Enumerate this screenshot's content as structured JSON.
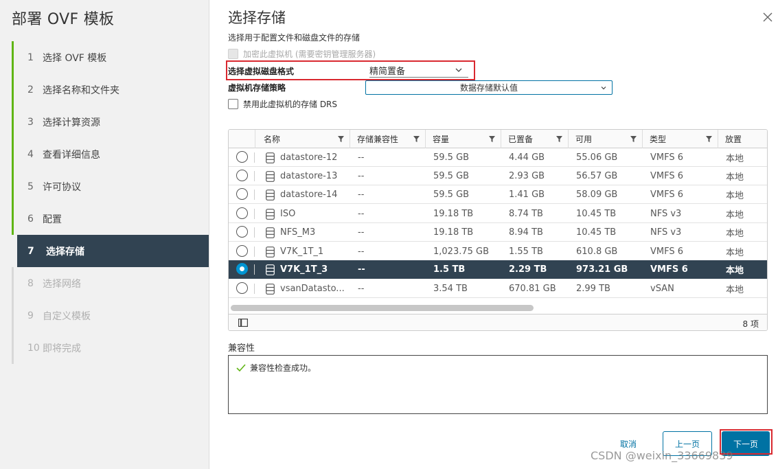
{
  "wizard": {
    "title": "部署 OVF 模板",
    "steps": [
      {
        "num": "1",
        "label": "选择 OVF 模板",
        "state": "done"
      },
      {
        "num": "2",
        "label": "选择名称和文件夹",
        "state": "done"
      },
      {
        "num": "3",
        "label": "选择计算资源",
        "state": "done"
      },
      {
        "num": "4",
        "label": "查看详细信息",
        "state": "done"
      },
      {
        "num": "5",
        "label": "许可协议",
        "state": "done"
      },
      {
        "num": "6",
        "label": "配置",
        "state": "done"
      },
      {
        "num": "7",
        "label": "选择存储",
        "state": "active"
      },
      {
        "num": "8",
        "label": "选择网络",
        "state": "future"
      },
      {
        "num": "9",
        "label": "自定义模板",
        "state": "future"
      },
      {
        "num": "10",
        "label": "即将完成",
        "state": "future"
      }
    ]
  },
  "page": {
    "title": "选择存储",
    "subtitle": "选择用于配置文件和磁盘文件的存储",
    "encrypt_label": "加密此虚拟机 (需要密钥管理服务器)",
    "disk_format_label": "选择虚拟磁盘格式",
    "disk_format_value": "精简置备",
    "policy_label": "虚拟机存储策略",
    "policy_value": "数据存储默认值",
    "disable_drs_label": "禁用此虚拟机的存储 DRS"
  },
  "grid": {
    "columns": [
      "名称",
      "存储兼容性",
      "容量",
      "已置备",
      "可用",
      "类型",
      "放置"
    ],
    "rows": [
      {
        "name": "datastore-12",
        "compat": "--",
        "capacity": "59.5 GB",
        "provisioned": "4.44 GB",
        "free": "55.06 GB",
        "type": "VMFS 6",
        "placement": "本地",
        "selected": false
      },
      {
        "name": "datastore-13",
        "compat": "--",
        "capacity": "59.5 GB",
        "provisioned": "2.93 GB",
        "free": "56.57 GB",
        "type": "VMFS 6",
        "placement": "本地",
        "selected": false
      },
      {
        "name": "datastore-14",
        "compat": "--",
        "capacity": "59.5 GB",
        "provisioned": "1.41 GB",
        "free": "58.09 GB",
        "type": "VMFS 6",
        "placement": "本地",
        "selected": false
      },
      {
        "name": "ISO",
        "compat": "--",
        "capacity": "19.18 TB",
        "provisioned": "8.74 TB",
        "free": "10.45 TB",
        "type": "NFS v3",
        "placement": "本地",
        "selected": false
      },
      {
        "name": "NFS_M3",
        "compat": "--",
        "capacity": "19.18 TB",
        "provisioned": "8.94 TB",
        "free": "10.45 TB",
        "type": "NFS v3",
        "placement": "本地",
        "selected": false
      },
      {
        "name": "V7K_1T_1",
        "compat": "--",
        "capacity": "1,023.75 GB",
        "provisioned": "1.55 TB",
        "free": "610.8 GB",
        "type": "VMFS 6",
        "placement": "本地",
        "selected": false
      },
      {
        "name": "V7K_1T_3",
        "compat": "--",
        "capacity": "1.5 TB",
        "provisioned": "2.29 TB",
        "free": "973.21 GB",
        "type": "VMFS 6",
        "placement": "本地",
        "selected": true
      },
      {
        "name": "vsanDatasto...",
        "compat": "--",
        "capacity": "3.54 TB",
        "provisioned": "670.81 GB",
        "free": "2.99 TB",
        "type": "vSAN",
        "placement": "本地",
        "selected": false
      }
    ],
    "item_count": "8 项"
  },
  "compat": {
    "label": "兼容性",
    "message": "兼容性检查成功。"
  },
  "buttons": {
    "cancel": "取消",
    "back": "上一页",
    "next": "下一页"
  },
  "watermark": "CSDN @weixin_33669839",
  "colors": {
    "accent": "#0072a3",
    "selected_row": "#314352",
    "done_step": "#60b515",
    "highlight": "#d9282f",
    "radio_checked": "#0095d3"
  }
}
